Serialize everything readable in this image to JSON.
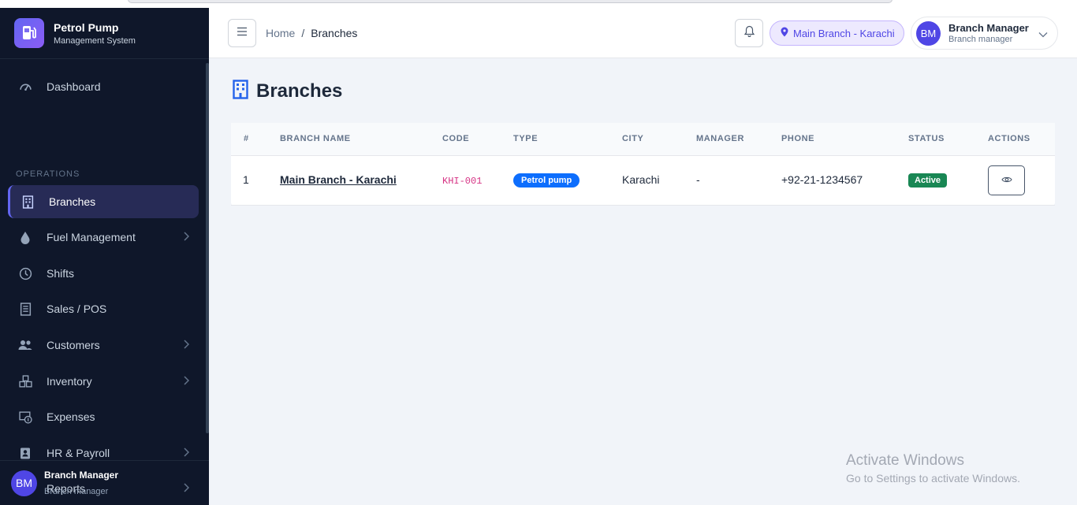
{
  "app": {
    "brand_title": "Petrol Pump",
    "brand_subtitle": "Management System"
  },
  "sidebar": {
    "section_operations": "OPERATIONS",
    "items": [
      {
        "label": "Dashboard",
        "icon": "gauge-icon"
      },
      {
        "label": "Branches",
        "icon": "building-icon",
        "active": true
      },
      {
        "label": "Fuel Management",
        "icon": "droplet-icon",
        "has_submenu": true
      },
      {
        "label": "Shifts",
        "icon": "clock-icon"
      },
      {
        "label": "Sales / POS",
        "icon": "receipt-icon"
      },
      {
        "label": "Customers",
        "icon": "people-icon",
        "has_submenu": true
      },
      {
        "label": "Inventory",
        "icon": "boxes-icon",
        "has_submenu": true
      },
      {
        "label": "Expenses",
        "icon": "cash-icon"
      },
      {
        "label": "HR & Payroll",
        "icon": "id-badge-icon",
        "has_submenu": true
      },
      {
        "label": "Reports",
        "icon": "bar-chart-icon",
        "has_submenu": true
      }
    ],
    "user": {
      "initials": "BM",
      "name": "Branch Manager",
      "role": "Branch manager"
    }
  },
  "header": {
    "breadcrumb_home": "Home",
    "breadcrumb_sep": "/",
    "breadcrumb_current": "Branches",
    "current_branch": "Main Branch - Karachi",
    "user": {
      "initials": "BM",
      "name": "Branch Manager",
      "role": "Branch manager"
    }
  },
  "page": {
    "title": "Branches"
  },
  "table": {
    "columns": [
      "#",
      "BRANCH NAME",
      "CODE",
      "TYPE",
      "CITY",
      "MANAGER",
      "PHONE",
      "STATUS",
      "ACTIONS"
    ],
    "rows": [
      {
        "index": "1",
        "branch_name": "Main Branch - Karachi",
        "code": "KHI-001",
        "type": "Petrol pump",
        "city": "Karachi",
        "manager": "-",
        "phone": "+92-21-1234567",
        "status": "Active"
      }
    ]
  },
  "watermark": {
    "line1": "Activate Windows",
    "line2": "Go to Settings to activate Windows."
  },
  "colors": {
    "sidebar_bg": "#0f172a",
    "accent": "#6366f1",
    "type_badge": "#0d6efd",
    "status_active": "#198754"
  }
}
